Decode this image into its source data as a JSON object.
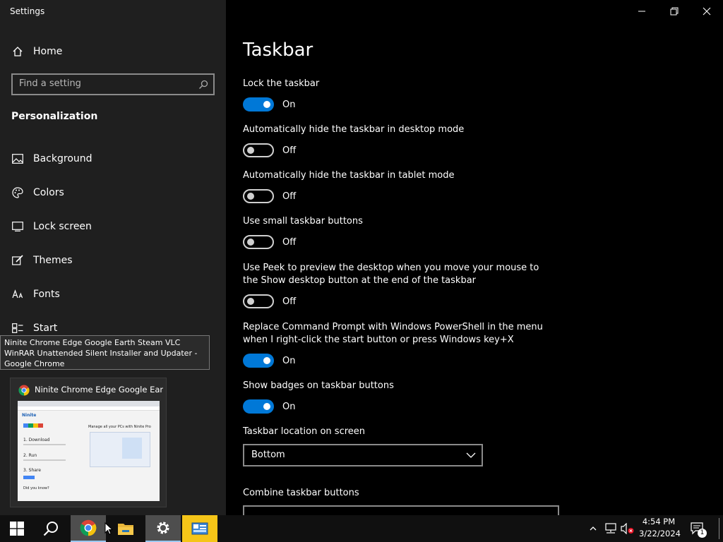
{
  "window": {
    "title": "Settings"
  },
  "sidebar": {
    "home": "Home",
    "search_placeholder": "Find a setting",
    "section": "Personalization",
    "items": [
      {
        "label": "Background",
        "icon": "background-icon"
      },
      {
        "label": "Colors",
        "icon": "colors-icon"
      },
      {
        "label": "Lock screen",
        "icon": "lock-screen-icon"
      },
      {
        "label": "Themes",
        "icon": "themes-icon"
      },
      {
        "label": "Fonts",
        "icon": "fonts-icon"
      },
      {
        "label": "Start",
        "icon": "start-icon"
      }
    ]
  },
  "main": {
    "title": "Taskbar",
    "settings": [
      {
        "label": "Lock the taskbar",
        "state": "On"
      },
      {
        "label": "Automatically hide the taskbar in desktop mode",
        "state": "Off"
      },
      {
        "label": "Automatically hide the taskbar in tablet mode",
        "state": "Off"
      },
      {
        "label": "Use small taskbar buttons",
        "state": "Off"
      },
      {
        "label": "Use Peek to preview the desktop when you move your mouse to the Show desktop button at the end of the taskbar",
        "state": "Off"
      },
      {
        "label": "Replace Command Prompt with Windows PowerShell in the menu when I right-click the start button or press Windows key+X",
        "state": "On"
      },
      {
        "label": "Show badges on taskbar buttons",
        "state": "On"
      }
    ],
    "location_label": "Taskbar location on screen",
    "location_value": "Bottom",
    "combine_label": "Combine taskbar buttons"
  },
  "tooltip": "Ninite Chrome Edge Google Earth Steam VLC WinRAR Unattended Silent Installer and Updater - Google Chrome",
  "thumbnail": {
    "title": "Ninite Chrome Edge Google Ear...",
    "page": {
      "brand": "Ninite",
      "headline": "Manage all your PCs with Ninite Pro",
      "steps": [
        "1. Download",
        "2. Run",
        "3. Share"
      ],
      "footer": "Did you know?"
    }
  },
  "taskbar": {
    "time": "4:54 PM",
    "date": "3/22/2024",
    "notification_count": "1"
  },
  "colors": {
    "accent": "#0078d7",
    "sidebar_bg": "#1f1f1f",
    "main_bg": "#000000",
    "taskbar_bg": "#101010"
  }
}
